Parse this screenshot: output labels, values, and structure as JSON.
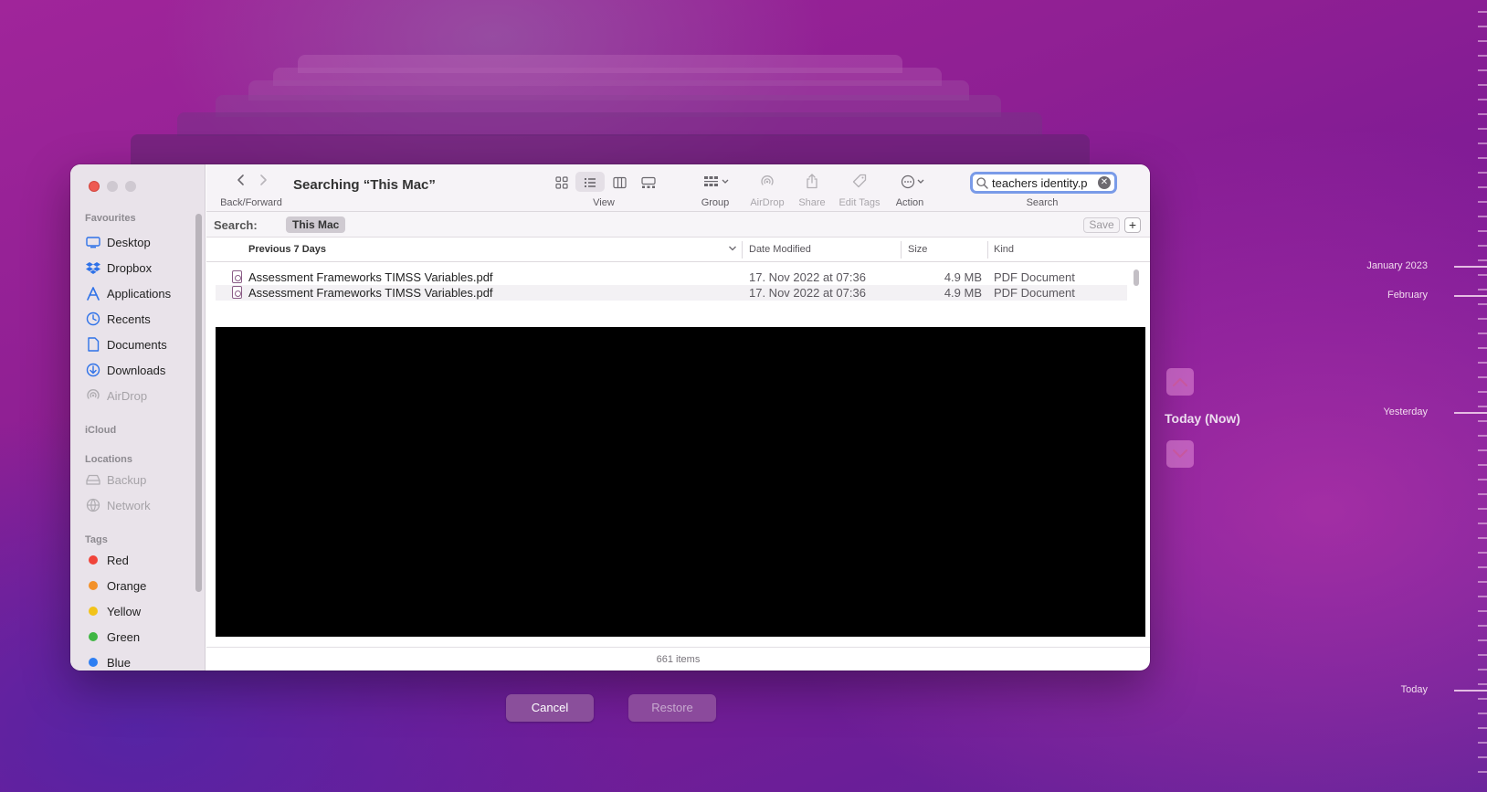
{
  "window": {
    "title": "Searching “This Mac”",
    "nav_label": "Back/Forward",
    "view_label": "View",
    "group_label": "Group",
    "airdrop_label": "AirDrop",
    "share_label": "Share",
    "edit_tags_label": "Edit Tags",
    "action_label": "Action",
    "search_label": "Search",
    "search_value": "teachers identity.p"
  },
  "sidebar": {
    "favourites_heading": "Favourites",
    "favourites": [
      {
        "label": "Desktop",
        "icon": "desktop-icon"
      },
      {
        "label": "Dropbox",
        "icon": "dropbox-icon"
      },
      {
        "label": "Applications",
        "icon": "applications-icon"
      },
      {
        "label": "Recents",
        "icon": "clock-icon"
      },
      {
        "label": "Documents",
        "icon": "document-icon"
      },
      {
        "label": "Downloads",
        "icon": "download-icon"
      },
      {
        "label": "AirDrop",
        "icon": "airdrop-icon"
      }
    ],
    "icloud_heading": "iCloud",
    "locations_heading": "Locations",
    "locations": [
      {
        "label": "Backup",
        "icon": "drive-icon"
      },
      {
        "label": "Network",
        "icon": "network-icon"
      }
    ],
    "tags_heading": "Tags",
    "tags": [
      {
        "label": "Red",
        "color": "#f0443a"
      },
      {
        "label": "Orange",
        "color": "#f39129"
      },
      {
        "label": "Yellow",
        "color": "#f2c31a"
      },
      {
        "label": "Green",
        "color": "#3fb643"
      },
      {
        "label": "Blue",
        "color": "#2d7ef2"
      }
    ]
  },
  "scope": {
    "label": "Search:",
    "chip": "This Mac",
    "save_label": "Save",
    "add_label": "+"
  },
  "columns": {
    "name": "Previous 7 Days",
    "date": "Date Modified",
    "size": "Size",
    "kind": "Kind"
  },
  "files": [
    {
      "name": "Assessment Frameworks TIMSS Variables.pdf",
      "date": "17. Nov 2022 at 07:36",
      "size": "4.9 MB",
      "kind": "PDF Document"
    },
    {
      "name": "Assessment Frameworks TIMSS Variables.pdf",
      "date": "17. Nov 2022 at 07:36",
      "size": "4.9 MB",
      "kind": "PDF Document"
    }
  ],
  "status": "661 items",
  "buttons": {
    "cancel": "Cancel",
    "restore": "Restore"
  },
  "time_machine": {
    "now_label": "Today (Now)",
    "timeline": {
      "jan": "January 2023",
      "feb": "February",
      "yesterday": "Yesterday",
      "today": "Today"
    }
  }
}
